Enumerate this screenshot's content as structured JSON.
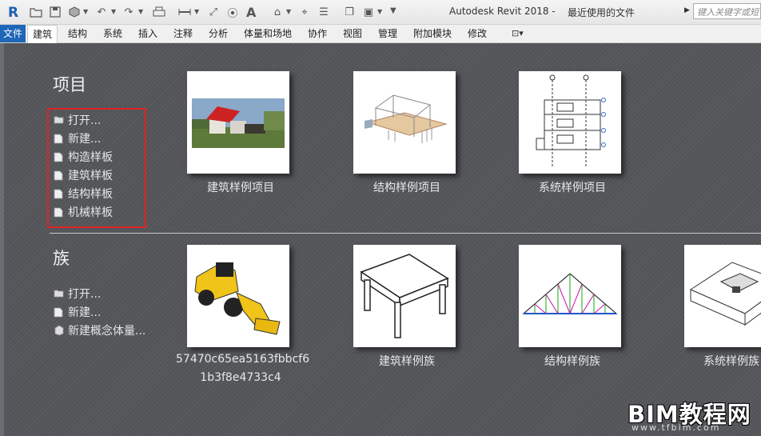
{
  "toolbar": {
    "app_title": "Autodesk Revit 2018 -",
    "document_title": "最近使用的文件",
    "search_placeholder": "键入关键字或短语",
    "icons": [
      "revit-logo",
      "open",
      "save",
      "sync",
      "undo",
      "redo",
      "print",
      "measure",
      "dimension",
      "tag",
      "text",
      "3d-view",
      "section",
      "thin-lines",
      "close-hidden",
      "switch-windows",
      "customize"
    ]
  },
  "tabs": {
    "file": "文件",
    "items": [
      "建筑",
      "结构",
      "系统",
      "插入",
      "注释",
      "分析",
      "体量和场地",
      "协作",
      "视图",
      "管理",
      "附加模块",
      "修改"
    ],
    "active": "建筑"
  },
  "projects": {
    "title": "项目",
    "links": [
      "打开...",
      "新建...",
      "构造样板",
      "建筑样板",
      "结构样板",
      "机械样板"
    ],
    "thumbnails": [
      {
        "caption": "建筑样例项目",
        "icon": "house-render"
      },
      {
        "caption": "结构样例项目",
        "icon": "structure-frame"
      },
      {
        "caption": "系统样例项目",
        "icon": "systems-drawing"
      }
    ]
  },
  "families": {
    "title": "族",
    "links": [
      "打开...",
      "新建...",
      "新建概念体量..."
    ],
    "thumbnails": [
      {
        "caption": "57470c65ea5163fbbcf6",
        "caption2": "1b3f8e4733c4",
        "icon": "loader-vehicle"
      },
      {
        "caption": "建筑样例族",
        "icon": "table"
      },
      {
        "caption": "结构样例族",
        "icon": "truss"
      },
      {
        "caption": "系统样例族",
        "icon": "box-fixture"
      }
    ]
  },
  "watermark": {
    "text": "BIM教程网",
    "url": "www.tfbim.com"
  }
}
